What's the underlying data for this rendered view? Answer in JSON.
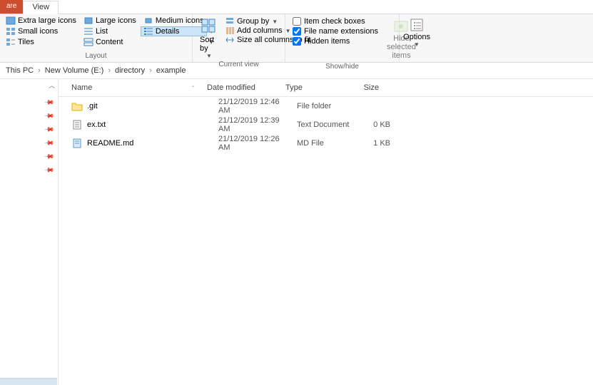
{
  "tabs": {
    "share": "are",
    "view": "View"
  },
  "ribbon": {
    "layout": {
      "label": "Layout",
      "options": [
        {
          "label": "Extra large icons"
        },
        {
          "label": "Large icons"
        },
        {
          "label": "Medium icons"
        },
        {
          "label": "Small icons"
        },
        {
          "label": "List"
        },
        {
          "label": "Details",
          "selected": true
        },
        {
          "label": "Tiles"
        },
        {
          "label": "Content"
        }
      ]
    },
    "sort": {
      "label": "Sort by"
    },
    "currentview": {
      "label": "Current view",
      "group_by": "Group by",
      "add_columns": "Add columns",
      "size_all": "Size all columns to fit"
    },
    "showhide": {
      "label": "Show/hide",
      "item_check": "Item check boxes",
      "fne": "File name extensions",
      "hidden": "Hidden items",
      "hide_selected": "Hide selected items"
    },
    "options": "Options"
  },
  "breadcrumb": [
    "This PC",
    "New Volume (E:)",
    "directory",
    "example"
  ],
  "columns": {
    "name": "Name",
    "date": "Date modified",
    "type": "Type",
    "size": "Size"
  },
  "files": [
    {
      "kind": "folder",
      "name": ".git",
      "date": "21/12/2019 12:46 AM",
      "type": "File folder",
      "size": ""
    },
    {
      "kind": "text",
      "name": "ex.txt",
      "date": "21/12/2019 12:39 AM",
      "type": "Text Document",
      "size": "0 KB"
    },
    {
      "kind": "md",
      "name": "README.md",
      "date": "21/12/2019 12:26 AM",
      "type": "MD File",
      "size": "1 KB"
    }
  ]
}
